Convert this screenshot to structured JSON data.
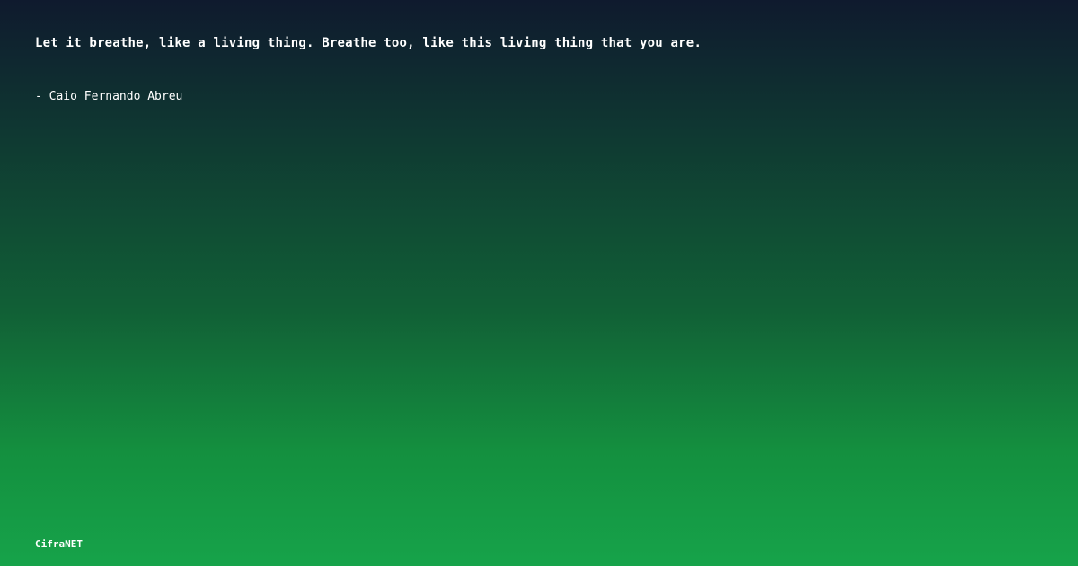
{
  "quote": {
    "text": "Let it breathe, like a living thing. Breathe too, like this living thing that you are.",
    "author": "- Caio Fernando Abreu"
  },
  "brand": {
    "name": "CifraNET"
  },
  "colors": {
    "background_top": "#0f1a2e",
    "background_bottom": "#16a34a",
    "text": "#ffffff"
  }
}
